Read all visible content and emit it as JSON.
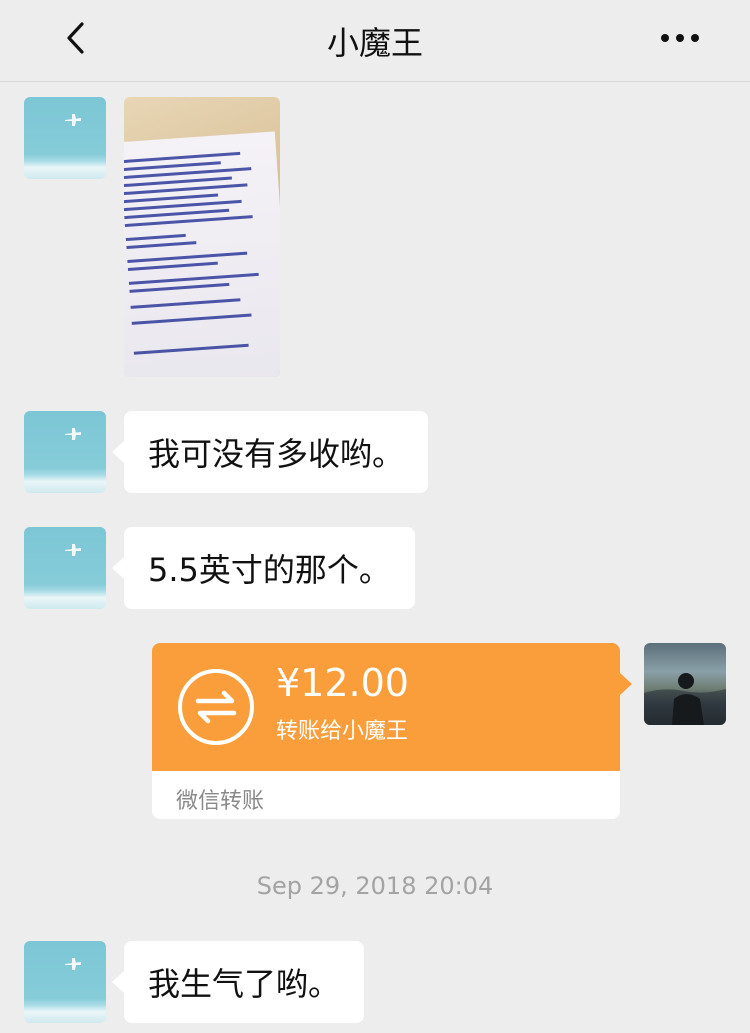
{
  "header": {
    "title": "小魔王",
    "back_icon": "chevron-left-icon",
    "more_icon": "more-dots-icon"
  },
  "messages": [
    {
      "type": "image",
      "sender": "contact",
      "content": "receipt-photo"
    },
    {
      "type": "text",
      "sender": "contact",
      "text": "我可没有多收哟。"
    },
    {
      "type": "text",
      "sender": "contact",
      "text": "5.5英寸的那个。"
    },
    {
      "type": "transfer",
      "sender": "me",
      "amount": "¥12.00",
      "description": "转账给小魔王",
      "footer": "微信转账"
    }
  ],
  "timestamp": "Sep 29, 2018 20:04",
  "messages_after": [
    {
      "type": "text",
      "sender": "contact",
      "text": "我生气了哟。"
    }
  ],
  "colors": {
    "background": "#ededed",
    "transfer_orange": "#fa9e3b",
    "bubble": "#ffffff"
  }
}
